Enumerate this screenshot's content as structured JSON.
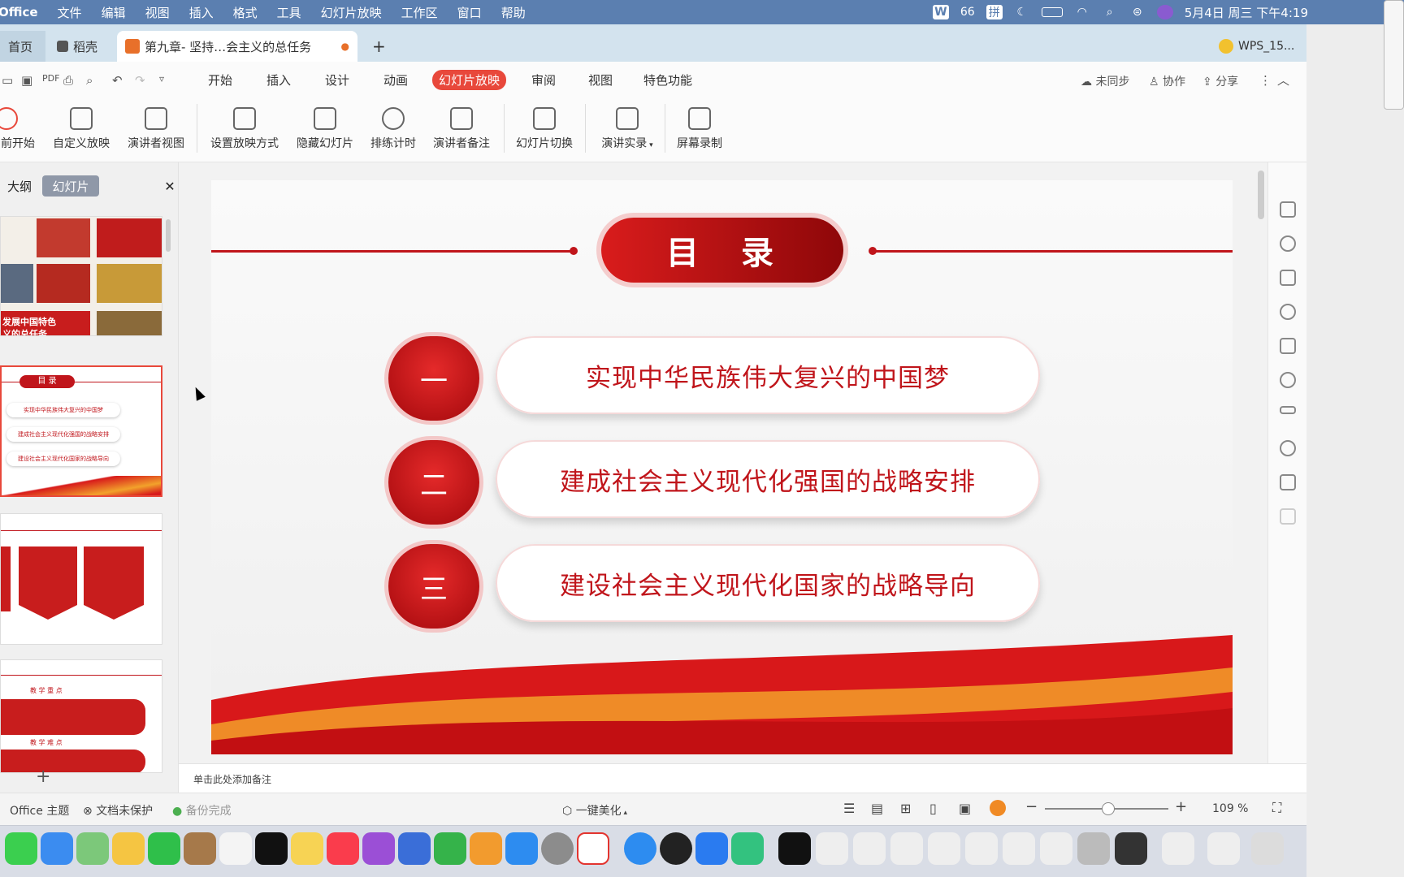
{
  "menubar": {
    "app": "Office",
    "items": [
      "文件",
      "编辑",
      "视图",
      "插入",
      "格式",
      "工具",
      "幻灯片放映",
      "工作区",
      "窗口",
      "帮助"
    ],
    "battery": "66",
    "datetime": "5月4日 周三 下午4:19"
  },
  "tabs": {
    "home": "首页",
    "straw": "稻壳",
    "doc": "第九章- 坚持…会主义的总任务",
    "wps": "WPS_15..."
  },
  "ribbon": {
    "tabs": [
      "开始",
      "插入",
      "设计",
      "动画",
      "幻灯片放映",
      "审阅",
      "视图",
      "特色功能"
    ],
    "active": "幻灯片放映",
    "sync": "未同步",
    "collab": "协作",
    "share": "分享",
    "buttons": [
      "前开始",
      "自定义放映",
      "演讲者视图",
      "设置放映方式",
      "隐藏幻灯片",
      "排练计时",
      "演讲者备注",
      "幻灯片切换",
      "演讲实录",
      "屏幕录制"
    ]
  },
  "left_panel": {
    "tab_outline": "大纲",
    "tab_slides": "幻灯片",
    "thumb1_text": "发展中国特色\n义的总任务",
    "thumb2_title": "目 录",
    "thumb2_items": [
      "实现中华民族伟大复兴的中国梦",
      "建成社会主义现代化强国的战略安排",
      "建设社会主义现代化国家的战略导向"
    ],
    "thumb4_heading1": "教 学 重 点",
    "thumb4_heading2": "教 学 难 点"
  },
  "slide": {
    "title": "目　录",
    "items": [
      {
        "num": "一",
        "text": "实现中华民族伟大复兴的中国梦"
      },
      {
        "num": "二",
        "text": "建成社会主义现代化强国的战略安排"
      },
      {
        "num": "三",
        "text": "建设社会主义现代化国家的战略导向"
      }
    ]
  },
  "notes_placeholder": "单击此处添加备注",
  "status": {
    "theme": "Office 主题",
    "protect": "文档未保护",
    "backup": "备份完成",
    "beautify": "一键美化",
    "zoom": "109 %"
  },
  "colors": {
    "accent": "#e8483b",
    "brand_red": "#c0151b",
    "menubar": "#5b7fb0"
  }
}
